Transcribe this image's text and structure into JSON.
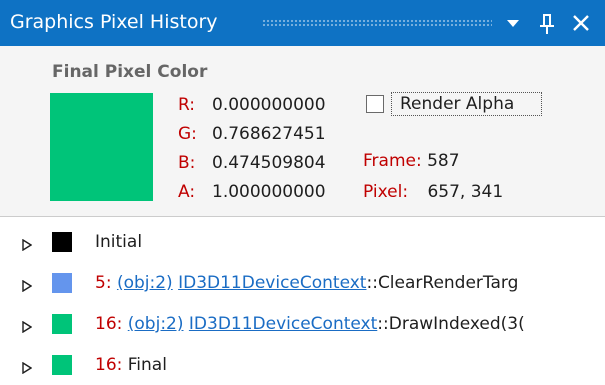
{
  "window": {
    "title": "Graphics Pixel History",
    "buttons": {
      "dropdown_icon": "chevron-down-icon",
      "pin_icon": "pin-icon",
      "close_icon": "close-icon"
    }
  },
  "final_pixel": {
    "section_title": "Final Pixel Color",
    "swatch_color": "#00c479",
    "components": [
      {
        "label": "R:",
        "value": "0.000000000"
      },
      {
        "label": "G:",
        "value": "0.768627451"
      },
      {
        "label": "B:",
        "value": "0.474509804"
      },
      {
        "label": "A:",
        "value": "1.000000000"
      }
    ],
    "render_alpha": {
      "label": "Render Alpha",
      "checked": false
    },
    "frame": {
      "label": "Frame:",
      "value": "587"
    },
    "pixel": {
      "label": "Pixel:",
      "value": "657, 341"
    }
  },
  "history": [
    {
      "swatch_color": "#000000",
      "index": "",
      "object": "",
      "context": "",
      "call": "Initial"
    },
    {
      "swatch_color": "#6495ed",
      "index": "5:",
      "object": "(obj:2)",
      "context": "ID3D11DeviceContext",
      "call": "::ClearRenderTarg"
    },
    {
      "swatch_color": "#00c479",
      "index": "16:",
      "object": "(obj:2)",
      "context": "ID3D11DeviceContext",
      "call": "::DrawIndexed(3("
    },
    {
      "swatch_color": "#00c479",
      "index": "16:",
      "object": "",
      "context": "",
      "call": "Final"
    }
  ],
  "colors": {
    "titlebar": "#0e72c4",
    "label_red": "#c00000",
    "link_blue": "#1a6cc4"
  }
}
